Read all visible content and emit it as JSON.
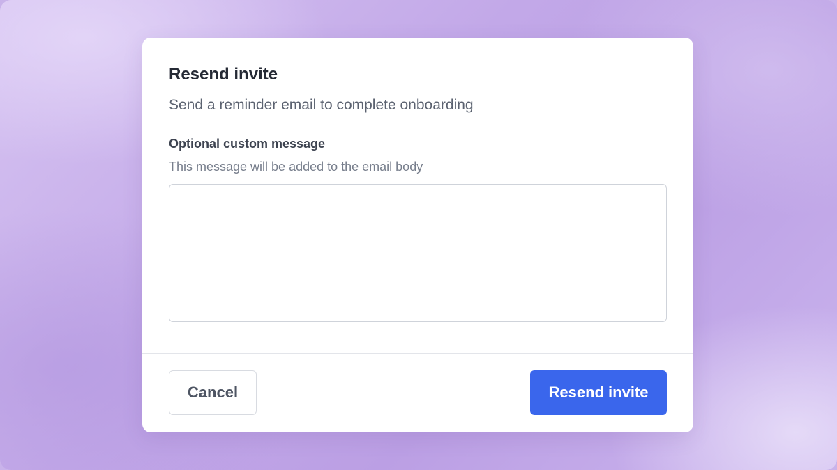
{
  "dialog": {
    "title": "Resend invite",
    "subtitle": "Send a reminder email to complete onboarding",
    "message_field": {
      "label": "Optional custom message",
      "help_text": "This message will be added to the email body",
      "value": "",
      "placeholder": ""
    },
    "footer": {
      "cancel_label": "Cancel",
      "submit_label": "Resend invite"
    }
  },
  "colors": {
    "primary": "#3a66ec",
    "background": "#c9b3ea",
    "title_text": "#252a35"
  }
}
